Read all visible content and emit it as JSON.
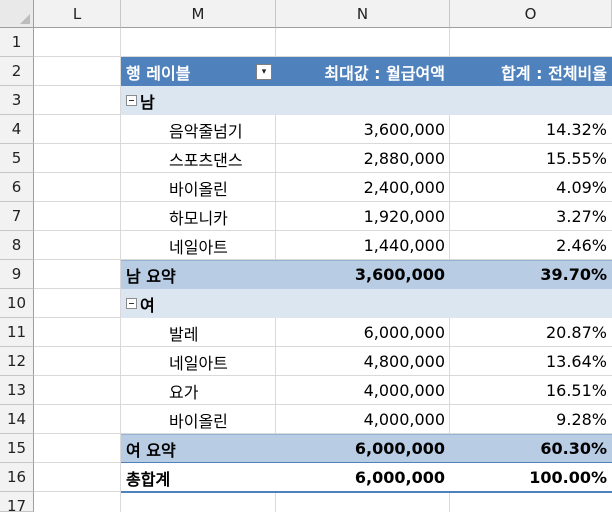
{
  "sheet": {
    "columns": [
      "L",
      "M",
      "N",
      "O"
    ],
    "rows": [
      "1",
      "2",
      "3",
      "4",
      "5",
      "6",
      "7",
      "8",
      "9",
      "10",
      "11",
      "12",
      "13",
      "14",
      "15",
      "16",
      "17"
    ]
  },
  "pivot": {
    "header": {
      "row_label": "행 레이블",
      "max_label": "최대값 : 월급여액",
      "sum_label": "합계 : 전체비율"
    },
    "groups": [
      {
        "name": "남",
        "items": [
          {
            "label": "음악줄넘기",
            "max": "3,600,000",
            "ratio": "14.32%"
          },
          {
            "label": "스포츠댄스",
            "max": "2,880,000",
            "ratio": "15.55%"
          },
          {
            "label": "바이올린",
            "max": "2,400,000",
            "ratio": "4.09%"
          },
          {
            "label": "하모니카",
            "max": "1,920,000",
            "ratio": "3.27%"
          },
          {
            "label": "네일아트",
            "max": "1,440,000",
            "ratio": "2.46%"
          }
        ],
        "subtotal": {
          "label": "남 요약",
          "max": "3,600,000",
          "ratio": "39.70%"
        }
      },
      {
        "name": "여",
        "items": [
          {
            "label": "발레",
            "max": "6,000,000",
            "ratio": "20.87%"
          },
          {
            "label": "네일아트",
            "max": "4,800,000",
            "ratio": "13.64%"
          },
          {
            "label": "요가",
            "max": "4,000,000",
            "ratio": "16.51%"
          },
          {
            "label": "바이올린",
            "max": "4,000,000",
            "ratio": "9.28%"
          }
        ],
        "subtotal": {
          "label": "여 요약",
          "max": "6,000,000",
          "ratio": "60.30%"
        }
      }
    ],
    "grand_total": {
      "label": "총합계",
      "max": "6,000,000",
      "ratio": "100.00%"
    }
  },
  "colors": {
    "header_band": "#4f81bd",
    "group_band": "#dce6f1",
    "subtotal_band": "#b8cce4"
  }
}
